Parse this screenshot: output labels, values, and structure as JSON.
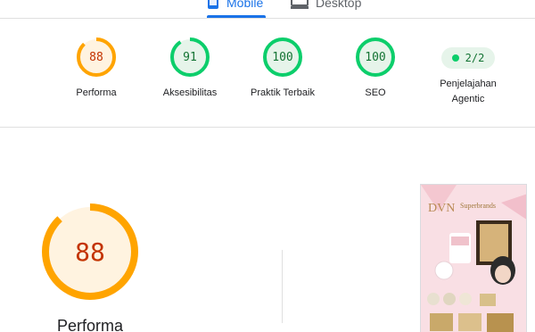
{
  "device_tabs": {
    "mobile_label": "Mobile",
    "desktop_label": "Desktop",
    "active": "mobile"
  },
  "scores": [
    {
      "key": "performance",
      "value": "88",
      "label": "Performa",
      "color": "#ffa400",
      "fill": "#fff3e0",
      "text_color": "#c33300",
      "fraction": 0.88
    },
    {
      "key": "accessibility",
      "value": "91",
      "label": "Aksesibilitas",
      "color": "#0cce6b",
      "fill": "#e6f4ea",
      "text_color": "#137333",
      "fraction": 0.91
    },
    {
      "key": "best-practices",
      "value": "100",
      "label": "Praktik Terbaik",
      "color": "#0cce6b",
      "fill": "#e6f4ea",
      "text_color": "#137333",
      "fraction": 1.0
    },
    {
      "key": "seo",
      "value": "100",
      "label": "SEO",
      "color": "#0cce6b",
      "fill": "#e6f4ea",
      "text_color": "#137333",
      "fraction": 1.0
    }
  ],
  "agentic": {
    "value": "2/2",
    "label_line1": "Penjelajahan",
    "label_line2": "Agentic",
    "color": "#0cce6b"
  },
  "detail": {
    "value": "88",
    "label": "Performa",
    "fraction": 0.88,
    "color": "#ffa400",
    "fill": "#fff3e0"
  },
  "thumbnail": {
    "brand_text": "DVN",
    "award_text": "Superbrands",
    "icon": "page-screenshot-thumbnail"
  }
}
